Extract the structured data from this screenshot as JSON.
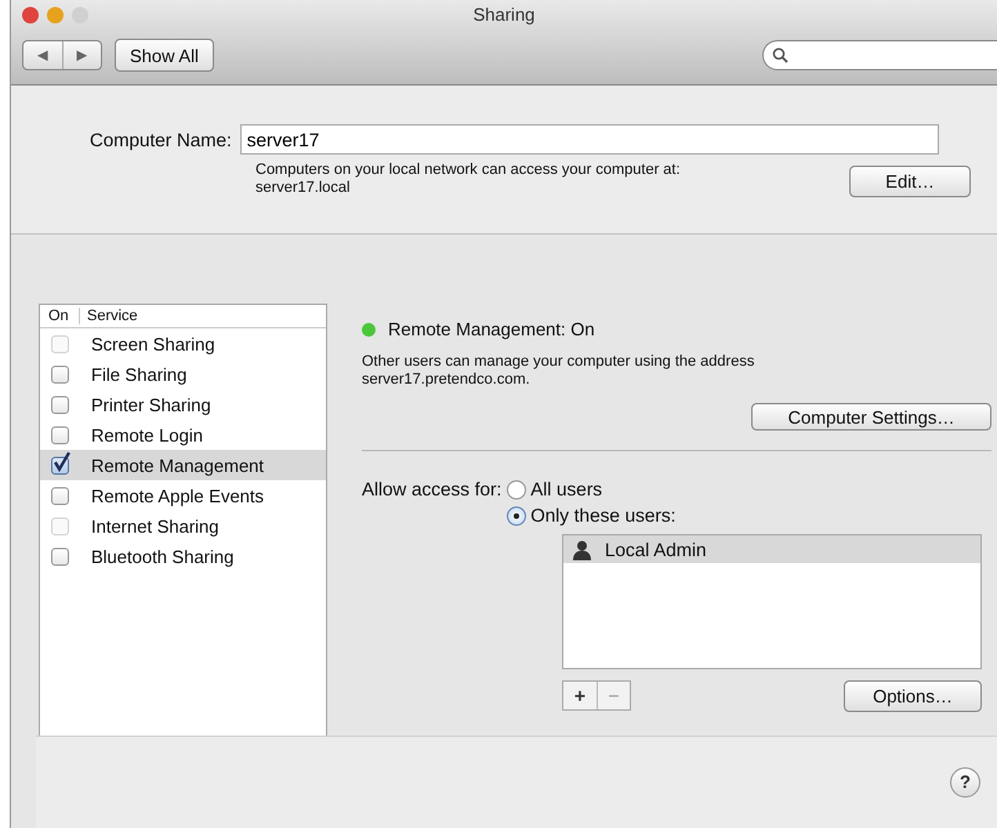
{
  "window": {
    "title": "Sharing"
  },
  "toolbar": {
    "back": "◀",
    "forward": "▶",
    "show_all": "Show All"
  },
  "computer_name": {
    "label": "Computer Name:",
    "value": "server17",
    "hint": "Computers on your local network can access your computer at:",
    "local_address": "server17.local",
    "edit_button": "Edit…"
  },
  "services": {
    "columns": [
      "On",
      "Service"
    ],
    "items": [
      {
        "name": "Screen Sharing",
        "checked": false,
        "disabled": true,
        "selected": false
      },
      {
        "name": "File Sharing",
        "checked": false,
        "disabled": false,
        "selected": false
      },
      {
        "name": "Printer Sharing",
        "checked": false,
        "disabled": false,
        "selected": false
      },
      {
        "name": "Remote Login",
        "checked": false,
        "disabled": false,
        "selected": false
      },
      {
        "name": "Remote Management",
        "checked": true,
        "disabled": false,
        "selected": true
      },
      {
        "name": "Remote Apple Events",
        "checked": false,
        "disabled": false,
        "selected": false
      },
      {
        "name": "Internet Sharing",
        "checked": false,
        "disabled": true,
        "selected": false
      },
      {
        "name": "Bluetooth Sharing",
        "checked": false,
        "disabled": false,
        "selected": false
      }
    ]
  },
  "detail": {
    "status": "Remote Management: On",
    "on": true,
    "description": "Other users can manage your computer using the address server17.pretendco.com.",
    "settings_button": "Computer Settings…",
    "access_label": "Allow access for:",
    "access_options": [
      {
        "label": "All users",
        "selected": false
      },
      {
        "label": "Only these users:",
        "selected": true
      }
    ],
    "users": [
      {
        "name": "Local Admin",
        "selected": true
      }
    ],
    "add": "+",
    "remove": "−",
    "options_button": "Options…"
  },
  "help": "?"
}
